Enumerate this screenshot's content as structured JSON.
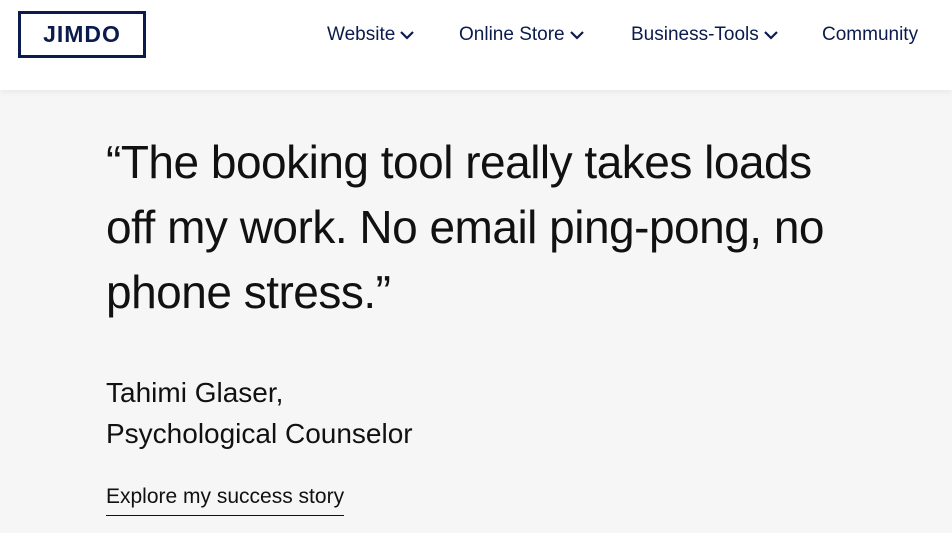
{
  "header": {
    "logo_text": "JIMDO",
    "nav": [
      {
        "label": "Website",
        "has_dropdown": true
      },
      {
        "label": "Online Store",
        "has_dropdown": true
      },
      {
        "label": "Business-Tools",
        "has_dropdown": true
      },
      {
        "label": "Community",
        "has_dropdown": false
      }
    ]
  },
  "testimonial": {
    "quote": "“The booking tool really takes loads off my work. No email ping-pong, no phone stress.”",
    "author_name": "Tahimi Glaser,",
    "author_title": "Psychological Counselor",
    "cta_label": "Explore my success story"
  },
  "colors": {
    "brand_navy": "#0b1b4d",
    "background": "#f6f6f6",
    "header_bg": "#ffffff",
    "text": "#111111"
  }
}
